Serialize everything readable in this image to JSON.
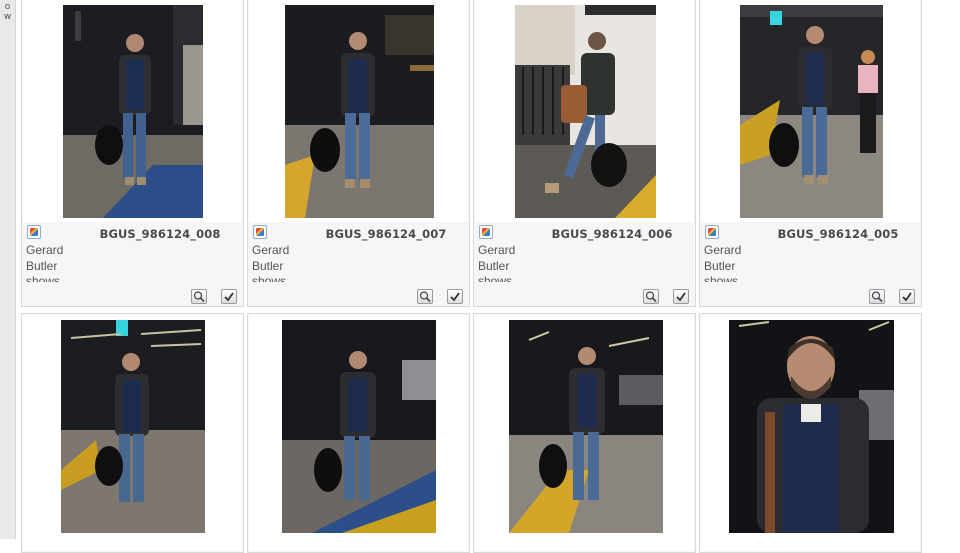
{
  "sidebar": {
    "letters": [
      "o",
      "w"
    ]
  },
  "cards": [
    {
      "id": "BGUS_986124_008",
      "caption": "Gerard Butler shows"
    },
    {
      "id": "BGUS_986124_007",
      "caption": "Gerard Butler shows"
    },
    {
      "id": "BGUS_986124_006",
      "caption": "Gerard Butler shows"
    },
    {
      "id": "BGUS_986124_005",
      "caption": "Gerard Butler shows"
    }
  ],
  "icons": {
    "meta": "photo-metadata-icon",
    "zoom": "magnifier-icon",
    "select": "checkmark-icon"
  },
  "colors": {
    "card_bg": "#f6f6f6",
    "card_border": "#d9d9d9",
    "filename_text": "#4a4a4a",
    "caption_text": "#555555"
  }
}
